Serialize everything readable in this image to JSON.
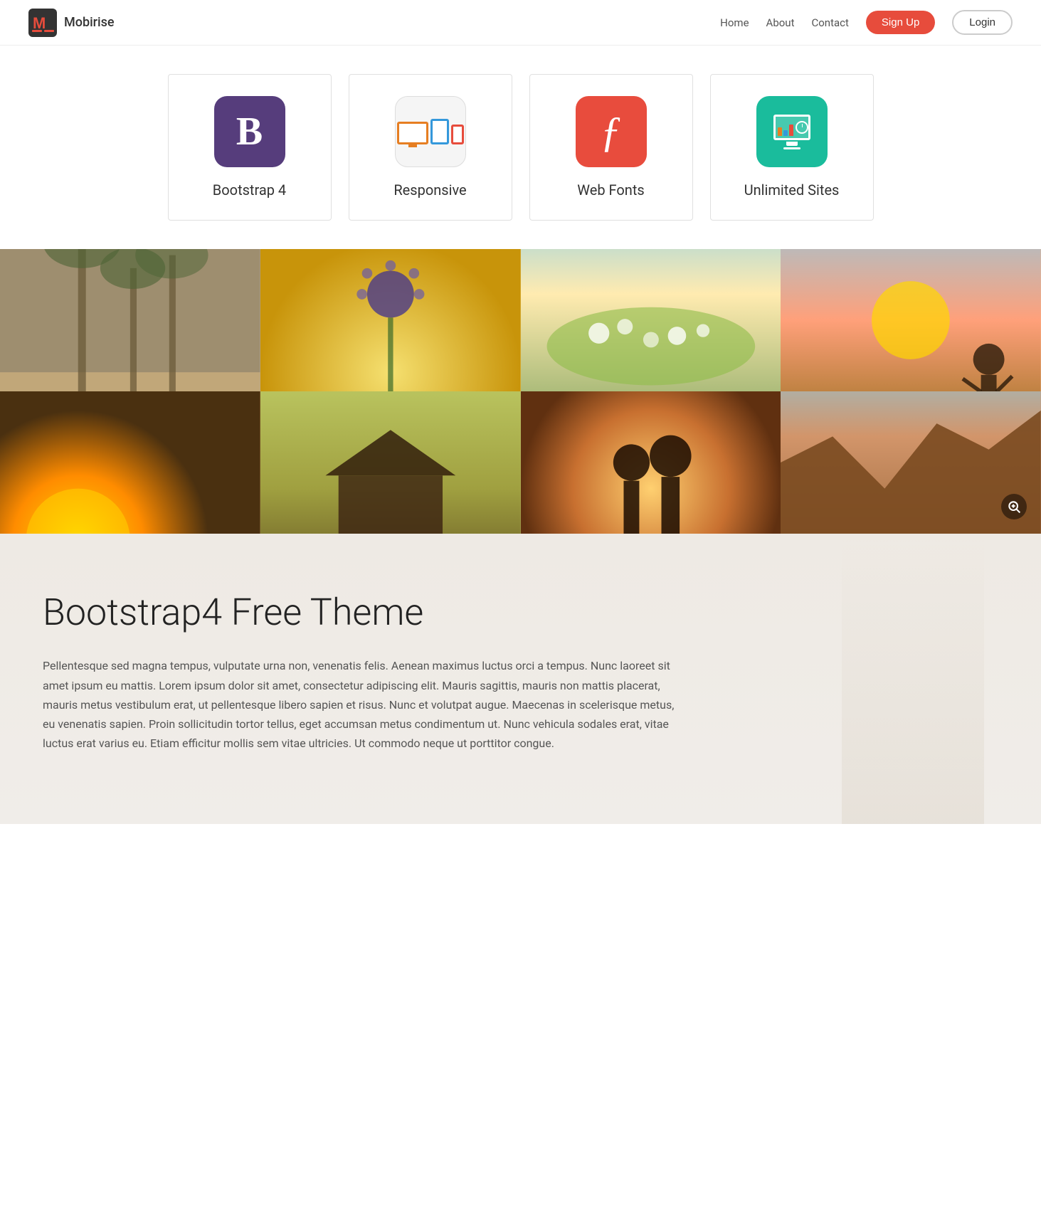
{
  "brand": {
    "name": "Mobirise",
    "logo_letter": "M"
  },
  "navbar": {
    "home": "Home",
    "about": "About",
    "contact": "Contact",
    "signup": "Sign Up",
    "login": "Login"
  },
  "features": [
    {
      "id": "bootstrap",
      "icon_type": "bootstrap",
      "label": "Bootstrap 4"
    },
    {
      "id": "responsive",
      "icon_type": "responsive",
      "label": "Responsive"
    },
    {
      "id": "webfonts",
      "icon_type": "webfonts",
      "label": "Web Fonts"
    },
    {
      "id": "unlimited",
      "icon_type": "unlimited",
      "label": "Unlimited Sites"
    }
  ],
  "content": {
    "title": "Bootstrap4 Free Theme",
    "body": "Pellentesque sed magna tempus, vulputate urna non, venenatis felis. Aenean maximus luctus orci a tempus. Nunc laoreet sit amet ipsum eu mattis. Lorem ipsum dolor sit amet, consectetur adipiscing elit. Mauris sagittis, mauris non mattis placerat, mauris metus vestibulum erat, ut pellentesque libero sapien et risus. Nunc et volutpat augue. Maecenas in scelerisque metus, eu venenatis sapien. Proin sollicitudin tortor tellus, eget accumsan metus condimentum ut. Nunc vehicula sodales erat, vitae luctus erat varius eu. Etiam efficitur mollis sem vitae ultricies. Ut commodo neque ut porttitor congue."
  },
  "zoom_icon": "⊕",
  "photos": [
    {
      "id": "palms",
      "class": "photo-palms"
    },
    {
      "id": "flower",
      "class": "photo-flower"
    },
    {
      "id": "meadow",
      "class": "photo-meadow"
    },
    {
      "id": "sunset-person",
      "class": "photo-sunset-person"
    },
    {
      "id": "sunburst",
      "class": "photo-sunburst"
    },
    {
      "id": "barn",
      "class": "photo-barn"
    },
    {
      "id": "couple",
      "class": "photo-couple"
    },
    {
      "id": "rocks",
      "class": "photo-rocks"
    }
  ]
}
